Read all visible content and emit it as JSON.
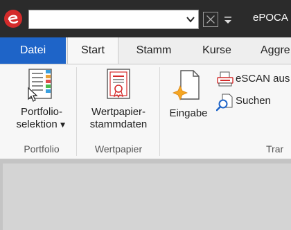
{
  "titlebar": {
    "title": "ePOCA",
    "combo_value": ""
  },
  "tabs": [
    {
      "label": "Datei"
    },
    {
      "label": "Start"
    },
    {
      "label": "Stamm"
    },
    {
      "label": "Kurse"
    },
    {
      "label": "Aggre"
    }
  ],
  "ribbon": {
    "groups": [
      {
        "label": "Portfolio",
        "buttons": [
          {
            "label_line1": "Portfolio-",
            "label_line2": "selektion",
            "dropdown_glyph": "▼",
            "icon": "portfolio-list-icon"
          }
        ]
      },
      {
        "label": "Wertpapier",
        "buttons": [
          {
            "label_line1": "Wertpapier-",
            "label_line2": "stammdaten",
            "icon": "certificate-icon"
          }
        ]
      },
      {
        "label": "Trar",
        "buttons": [
          {
            "label": "Eingabe",
            "icon": "new-document-icon"
          },
          {
            "label": "eSCAN aus",
            "icon": "scanner-icon"
          },
          {
            "label": "Suchen",
            "icon": "magnifier-document-icon"
          }
        ]
      }
    ]
  },
  "colors": {
    "titlebar_bg": "#2b2b2b",
    "file_tab": "#1e64c8",
    "ribbon_bg": "#f7f7f7",
    "accent_red": "#d42b2b"
  }
}
